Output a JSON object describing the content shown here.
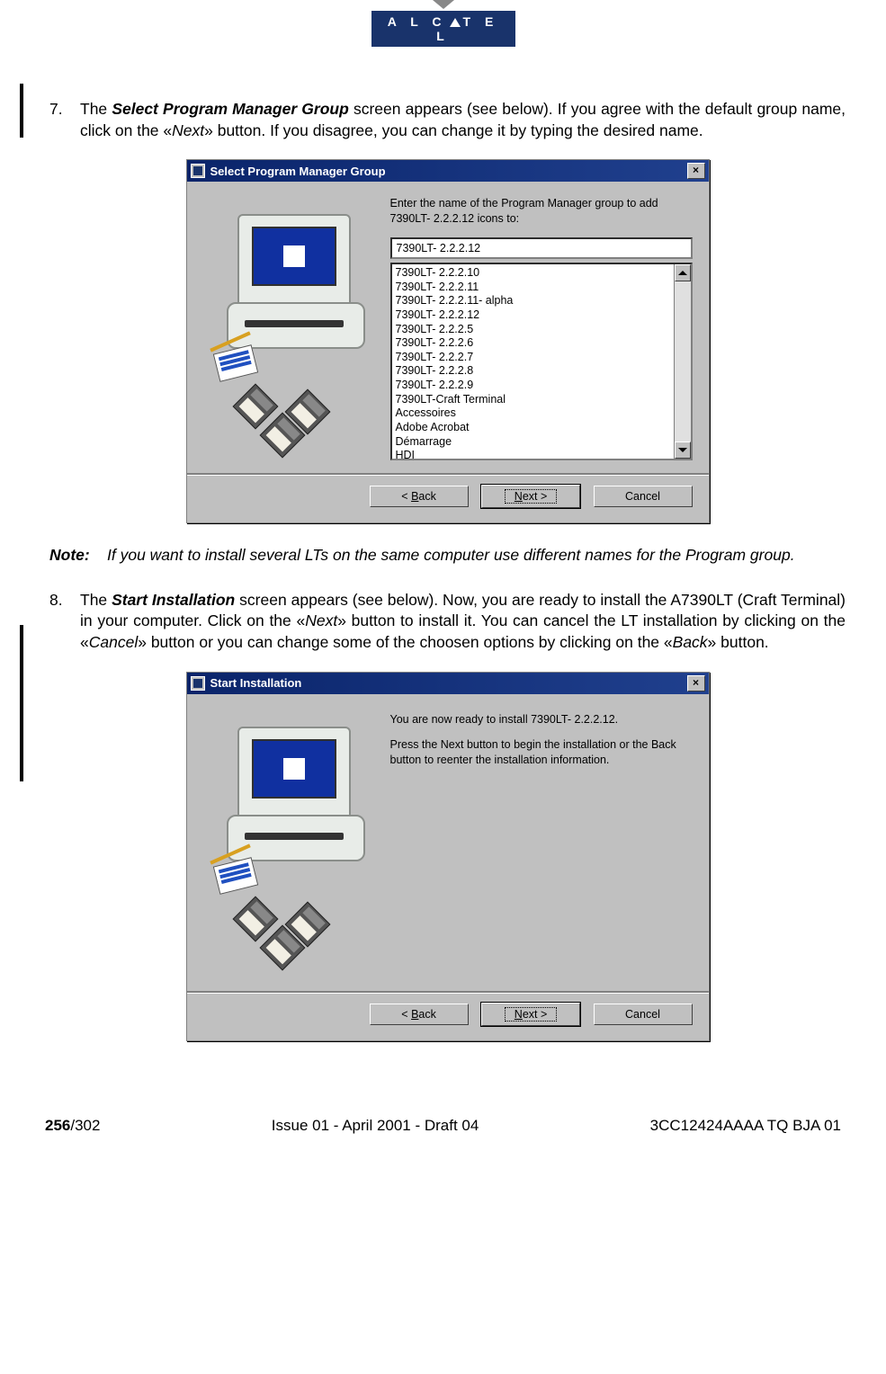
{
  "brand": "ALCATEL",
  "step7": {
    "num": "7.",
    "t1": "The ",
    "bi": "Select Program Manager Group",
    "t2": " screen appears (see below). If you agree with the default group name, click on the «",
    "it1": "Next",
    "t3": "» button. If you disagree, you can change it by typing the desired name."
  },
  "dialog1": {
    "title": "Select Program Manager Group",
    "prompt": "Enter the name of the Program Manager group to add 7390LT- 2.2.2.12 icons to:",
    "input_value": "7390LT- 2.2.2.12",
    "list": [
      "7390LT- 2.2.2.10",
      "7390LT- 2.2.2.11",
      "7390LT- 2.2.2.11- alpha",
      "7390LT- 2.2.2.12",
      "7390LT- 2.2.2.5",
      "7390LT- 2.2.2.6",
      "7390LT- 2.2.2.7",
      "7390LT- 2.2.2.8",
      "7390LT- 2.2.2.9",
      "7390LT-Craft Terminal",
      "Accessoires",
      "Adobe Acrobat",
      "Démarrage",
      "HDI"
    ],
    "back_pre": "< ",
    "back_u": "B",
    "back_post": "ack",
    "next_u": "N",
    "next_post": "ext >",
    "cancel": "Cancel",
    "close": "×"
  },
  "note": {
    "label": "Note:",
    "text": "If you want to install several LTs on the same computer use different names for the Program group."
  },
  "step8": {
    "num": "8.",
    "t1": "The ",
    "bi": "Start Installation",
    "t2": " screen appears (see below). Now, you are ready to install the A7390LT (Craft Terminal) in your computer. Click on the «",
    "it1": "Next",
    "t3": "» button to install it. You can cancel the LT installation by clicking on the «",
    "it2": "Cancel",
    "t4": "» button or you can change some of the choosen options by clicking on the «",
    "it3": "Back",
    "t5": "» button."
  },
  "dialog2": {
    "title": "Start Installation",
    "line1": "You are now ready to install 7390LT- 2.2.2.12.",
    "line2": "Press the Next button to begin the installation or the Back button to reenter the installation information."
  },
  "footer": {
    "page": "256",
    "total": "/302",
    "center": "Issue 01 - April 2001 - Draft 04",
    "right": "3CC12424AAAA TQ BJA 01"
  }
}
